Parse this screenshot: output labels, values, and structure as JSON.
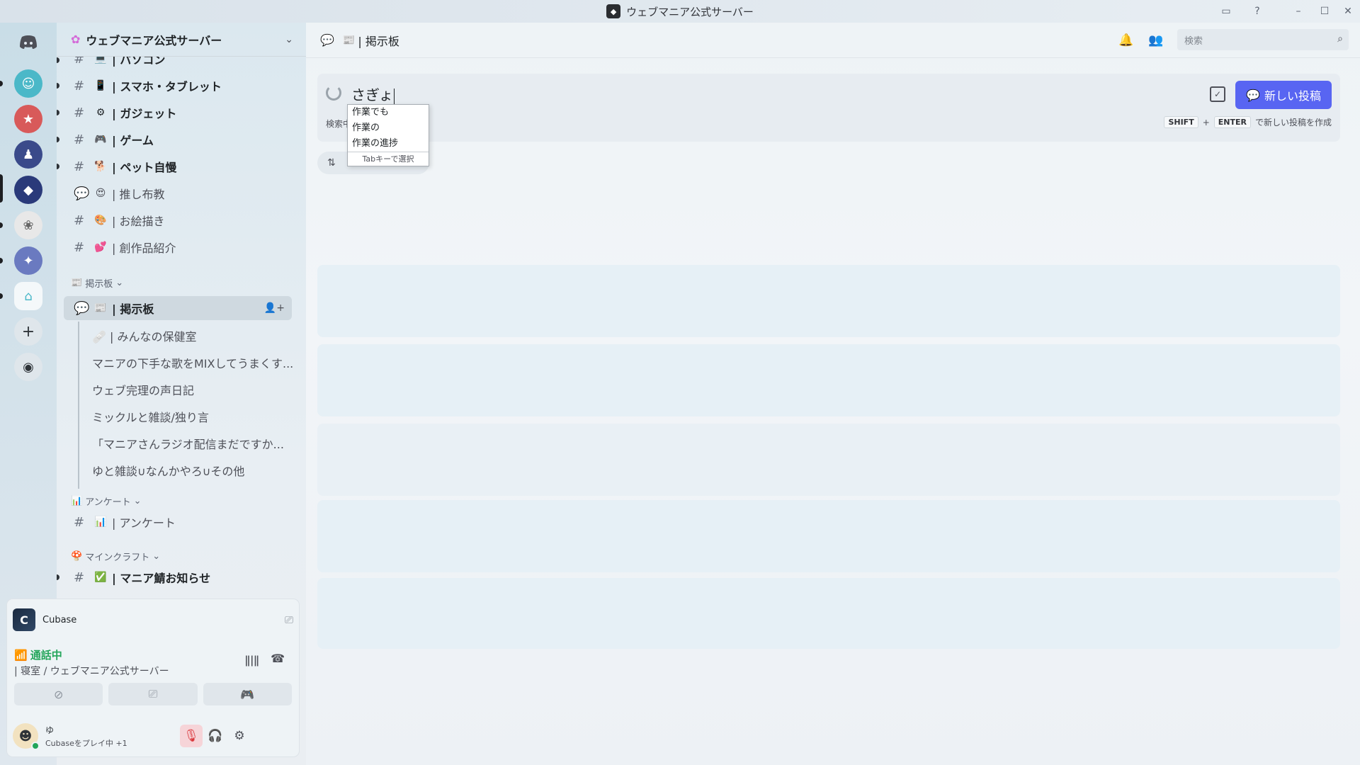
{
  "window": {
    "title": "ウェブマニア公式サーバー"
  },
  "server": {
    "name": "ウェブマニア公式サーバー"
  },
  "channels": [
    {
      "emoji": "💻",
      "label": "| パソコン"
    },
    {
      "emoji": "📱",
      "label": "| スマホ・タブレット"
    },
    {
      "emoji": "⚙",
      "label": "| ガジェット"
    },
    {
      "emoji": "🎮",
      "label": "| ゲーム"
    },
    {
      "emoji": "🐕",
      "label": "| ペット自慢"
    },
    {
      "emoji": "😍",
      "label": "| 推し布教"
    },
    {
      "emoji": "🎨",
      "label": "| お絵描き"
    },
    {
      "emoji": "💕",
      "label": "| 創作品紹介"
    }
  ],
  "categories": {
    "board": "掲示板",
    "survey": "アンケート",
    "minecraft": "マインクラフト"
  },
  "board_channel": {
    "emoji": "📰",
    "label": "| 掲示板"
  },
  "threads": [
    "🩹 | みんなの保健室",
    "マニアの下手な歌をMIXしてうまくす...",
    "ウェブ完理の声日記",
    "ミックルと雑談/独り言",
    "「マニアさんラジオ配信まだですか...",
    "ゆと雑談∪なんかやろ∪その他"
  ],
  "survey_channel": {
    "emoji": "📊",
    "label": "| アンケート"
  },
  "minecraft_channel": {
    "emoji": "✅",
    "label": "| マニア鯖お知らせ"
  },
  "activity": {
    "app": "Cubase"
  },
  "voice": {
    "status": "通話中",
    "location": "| 寝室 / ウェブマニア公式サーバー"
  },
  "user": {
    "name": "ゆ",
    "status": "Cubaseをプレイ中 +1"
  },
  "topbar": {
    "channel": "| 掲示板",
    "search_placeholder": "検索"
  },
  "composer": {
    "input": "さぎょ",
    "hint_left": "検索中",
    "kbd_shift": "SHIFT",
    "plus": "+",
    "kbd_enter": "ENTER",
    "hint_right": "で新しい投稿を作成",
    "new_post": "新しい投稿"
  },
  "ime": {
    "candidates": [
      "作業でも",
      "作業の",
      "作業の進捗"
    ],
    "footer": "Tabキーで選択"
  },
  "colors": {
    "accent": "#5865f2",
    "online": "#23a55a"
  },
  "icons": [
    "discord-icon",
    "bell-icon",
    "members-icon",
    "search-icon",
    "forum-icon",
    "add-server-icon",
    "explore-icon",
    "settings-icon",
    "headphones-icon",
    "mic-muted-icon"
  ]
}
